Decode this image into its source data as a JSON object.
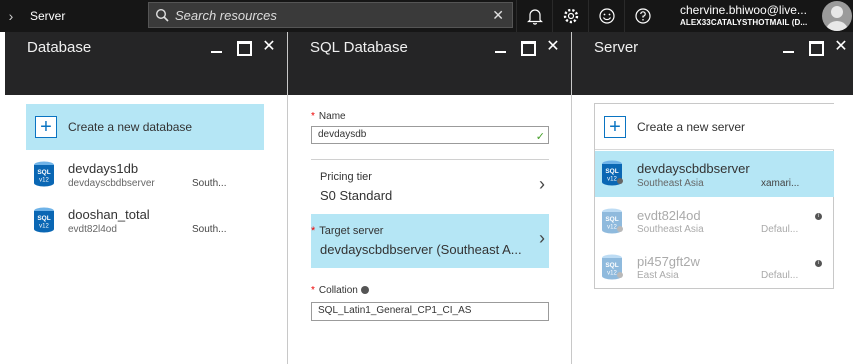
{
  "topbar": {
    "breadcrumb": "Server",
    "search_placeholder": "Search resources",
    "account_name": "chervine.bhiwoo@live...",
    "account_directory": "ALEX33CATALYSTHOTMAIL (D..."
  },
  "blades": {
    "database": {
      "title": "Database",
      "create_label": "Create a new database",
      "items": [
        {
          "name": "devdays1db",
          "server": "devdayscbdbserver",
          "location": "South..."
        },
        {
          "name": "dooshan_total",
          "server": "evdt82l4od",
          "location": "South..."
        }
      ]
    },
    "sql_database": {
      "title": "SQL Database",
      "name_label": "Name",
      "name_value": "devdaysdb",
      "pricing_label": "Pricing tier",
      "pricing_value": "S0 Standard",
      "target_label": "Target server",
      "target_value": "devdayscbdbserver (Southeast A...",
      "collation_label": "Collation",
      "collation_value": "SQL_Latin1_General_CP1_CI_AS"
    },
    "server": {
      "title": "Server",
      "create_label": "Create a new server",
      "items": [
        {
          "name": "devdayscbdbserver",
          "location": "Southeast Asia",
          "extra": "xamari..."
        },
        {
          "name": "evdt82l4od",
          "location": "Southeast Asia",
          "extra": "Defaul..."
        },
        {
          "name": "pi457gft2w",
          "location": "East Asia",
          "extra": "Defaul..."
        }
      ]
    }
  },
  "sql_icon_text": {
    "top": "SQL",
    "bottom": "v12"
  },
  "colors": {
    "accent_tile": "#b5e6f5",
    "topbar": "#161616",
    "blade_header": "#252526",
    "sql_icon_blue": "#0a67b4",
    "valid_check": "#46a02a"
  }
}
